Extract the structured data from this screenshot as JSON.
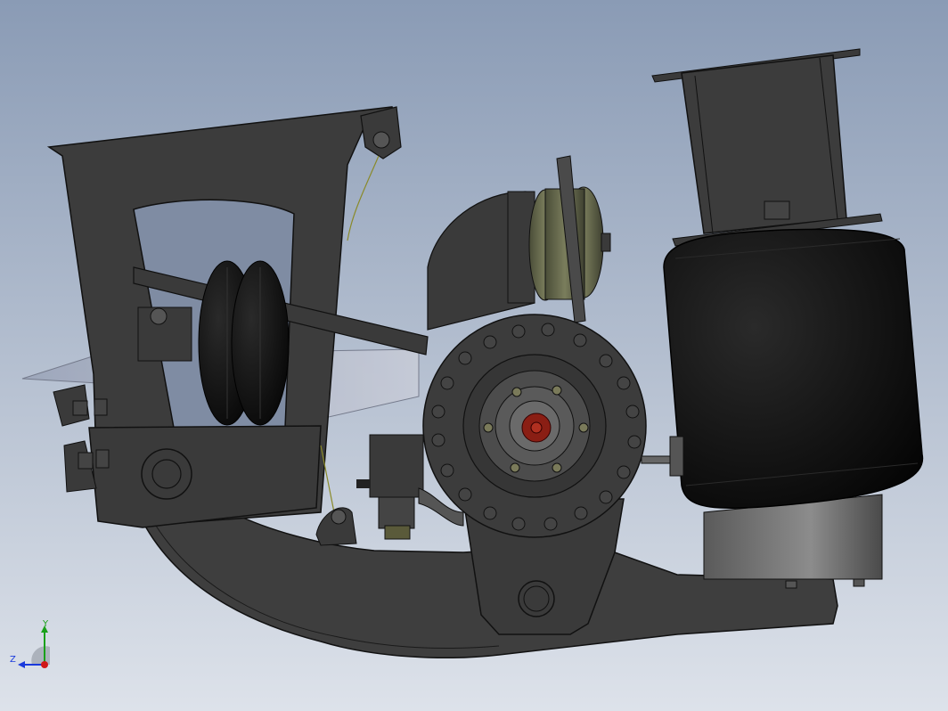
{
  "viewport": {
    "background_top": "#8a9bb5",
    "background_bottom": "#dde2ea"
  },
  "model": {
    "part_color": "#3e3e3e",
    "edge_color": "#111111",
    "air_spring_color": "#0f0f0f",
    "brake_chamber_color": "#5c6046",
    "hub_center_color": "#8a1e14",
    "wire_color": "#8a8a2a"
  },
  "triad": {
    "y_label": "Y",
    "z_label": "Z",
    "y_color": "#1aa01a",
    "z_color": "#1a3adc",
    "origin_color": "#d01818"
  }
}
